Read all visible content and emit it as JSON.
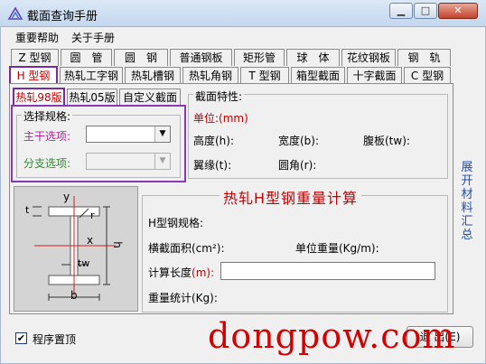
{
  "window": {
    "title": "截面查询手册"
  },
  "menu": {
    "items": [
      "重要帮助",
      "关于手册"
    ]
  },
  "tabs_row1": [
    "Z 型钢",
    "圆　管",
    "圆　钢",
    "普通钢板",
    "矩形管",
    "球　体",
    "花纹钢板",
    "钢　轨"
  ],
  "tabs_row2": [
    "H 型钢",
    "热轧工字钢",
    "热轧槽钢",
    "热轧角钢",
    "T 型钢",
    "箱型截面",
    "十字截面",
    "C 型钢"
  ],
  "sub_tabs": [
    "热轧98版",
    "热轧05版",
    "自定义截面"
  ],
  "select_spec": {
    "title": "选择规格:",
    "main_label": "主干选项:",
    "branch_label": "分支选项:",
    "main_value": "",
    "branch_value": ""
  },
  "section_props": {
    "title": "截面特性:",
    "unit": "单位:(mm)",
    "height": "高度(h):",
    "width": "宽度(b):",
    "web": "腹板(tw):",
    "flange": "翼缘(t):",
    "radius": "圆角(r):"
  },
  "diagram": {
    "labels": {
      "y": "y",
      "x": "x",
      "h": "h",
      "t": "t",
      "r": "r",
      "tw": "tw",
      "b": "b"
    }
  },
  "weight_calc": {
    "title": "热轧H型钢重量计算",
    "spec": "H型钢规格:",
    "area": "横截面积(cm²):",
    "unit_weight": "单位重量(Kg/m):",
    "length_label": "计算长度",
    "length_unit": "(m):",
    "length_value": "",
    "total": "重量统计(Kg):"
  },
  "side_link": "展开材料汇总",
  "options": {
    "pin_label": "程序置顶",
    "pin_checked": true
  },
  "exit_label": "退 出(E)",
  "watermark": "dongpow.com",
  "colors": {
    "active_tab_border": "#8a3ab0",
    "red_text": "#c00000",
    "green_text": "#2e8b2e",
    "link_blue": "#1f4ea8"
  }
}
